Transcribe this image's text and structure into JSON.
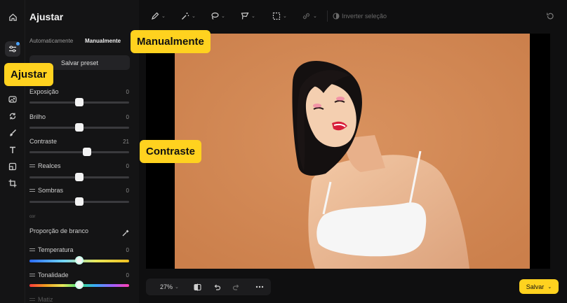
{
  "rail": {
    "items": [
      {
        "icon": "home-icon"
      },
      {
        "icon": "sliders-icon",
        "active": true
      },
      {
        "icon": "image-effects-icon"
      },
      {
        "icon": "rotate-icon"
      },
      {
        "icon": "brush-icon"
      },
      {
        "icon": "text-icon"
      },
      {
        "icon": "resize-icon"
      },
      {
        "icon": "crop-icon"
      }
    ]
  },
  "panel": {
    "title": "Ajustar",
    "tabs": [
      {
        "label": "Automaticamente",
        "active": false
      },
      {
        "label": "Manualmente",
        "active": true
      }
    ],
    "preset_button": "Salvar preset",
    "controls": [
      {
        "label": "Exposição",
        "value": "0",
        "level": 0.5,
        "icon": false
      },
      {
        "label": "Brilho",
        "value": "0",
        "level": 0.5,
        "icon": false
      },
      {
        "label": "Contraste",
        "value": "21",
        "level": 0.58,
        "icon": false
      },
      {
        "label": "Realces",
        "value": "0",
        "level": 0.5,
        "icon": true
      },
      {
        "label": "Sombras",
        "value": "0",
        "level": 0.5,
        "icon": true
      }
    ],
    "section_caption": "cor",
    "white_balance_label": "Proporção de branco",
    "color_controls": [
      {
        "label": "Temperatura",
        "value": "0",
        "level": 0.5
      },
      {
        "label": "Tonalidade",
        "value": "0",
        "level": 0.5
      }
    ],
    "partial_label": "Matiz"
  },
  "toolbar": {
    "tools": [
      "pen-icon",
      "magic-wand-icon",
      "lasso-icon",
      "polygon-lasso-icon",
      "select-rect-icon",
      "link-icon"
    ],
    "invert_selection": "Inverter seleção",
    "undo_history_icon": "history-icon"
  },
  "bottom_bar": {
    "zoom": "27%"
  },
  "save_button": "Salvar",
  "callouts": {
    "tab": "Manualmente",
    "rail": "Ajustar",
    "control": "Contraste"
  },
  "colors": {
    "accent": "#ffd21f",
    "photo_bg": "#d58a55",
    "panel_bg": "#141415"
  }
}
